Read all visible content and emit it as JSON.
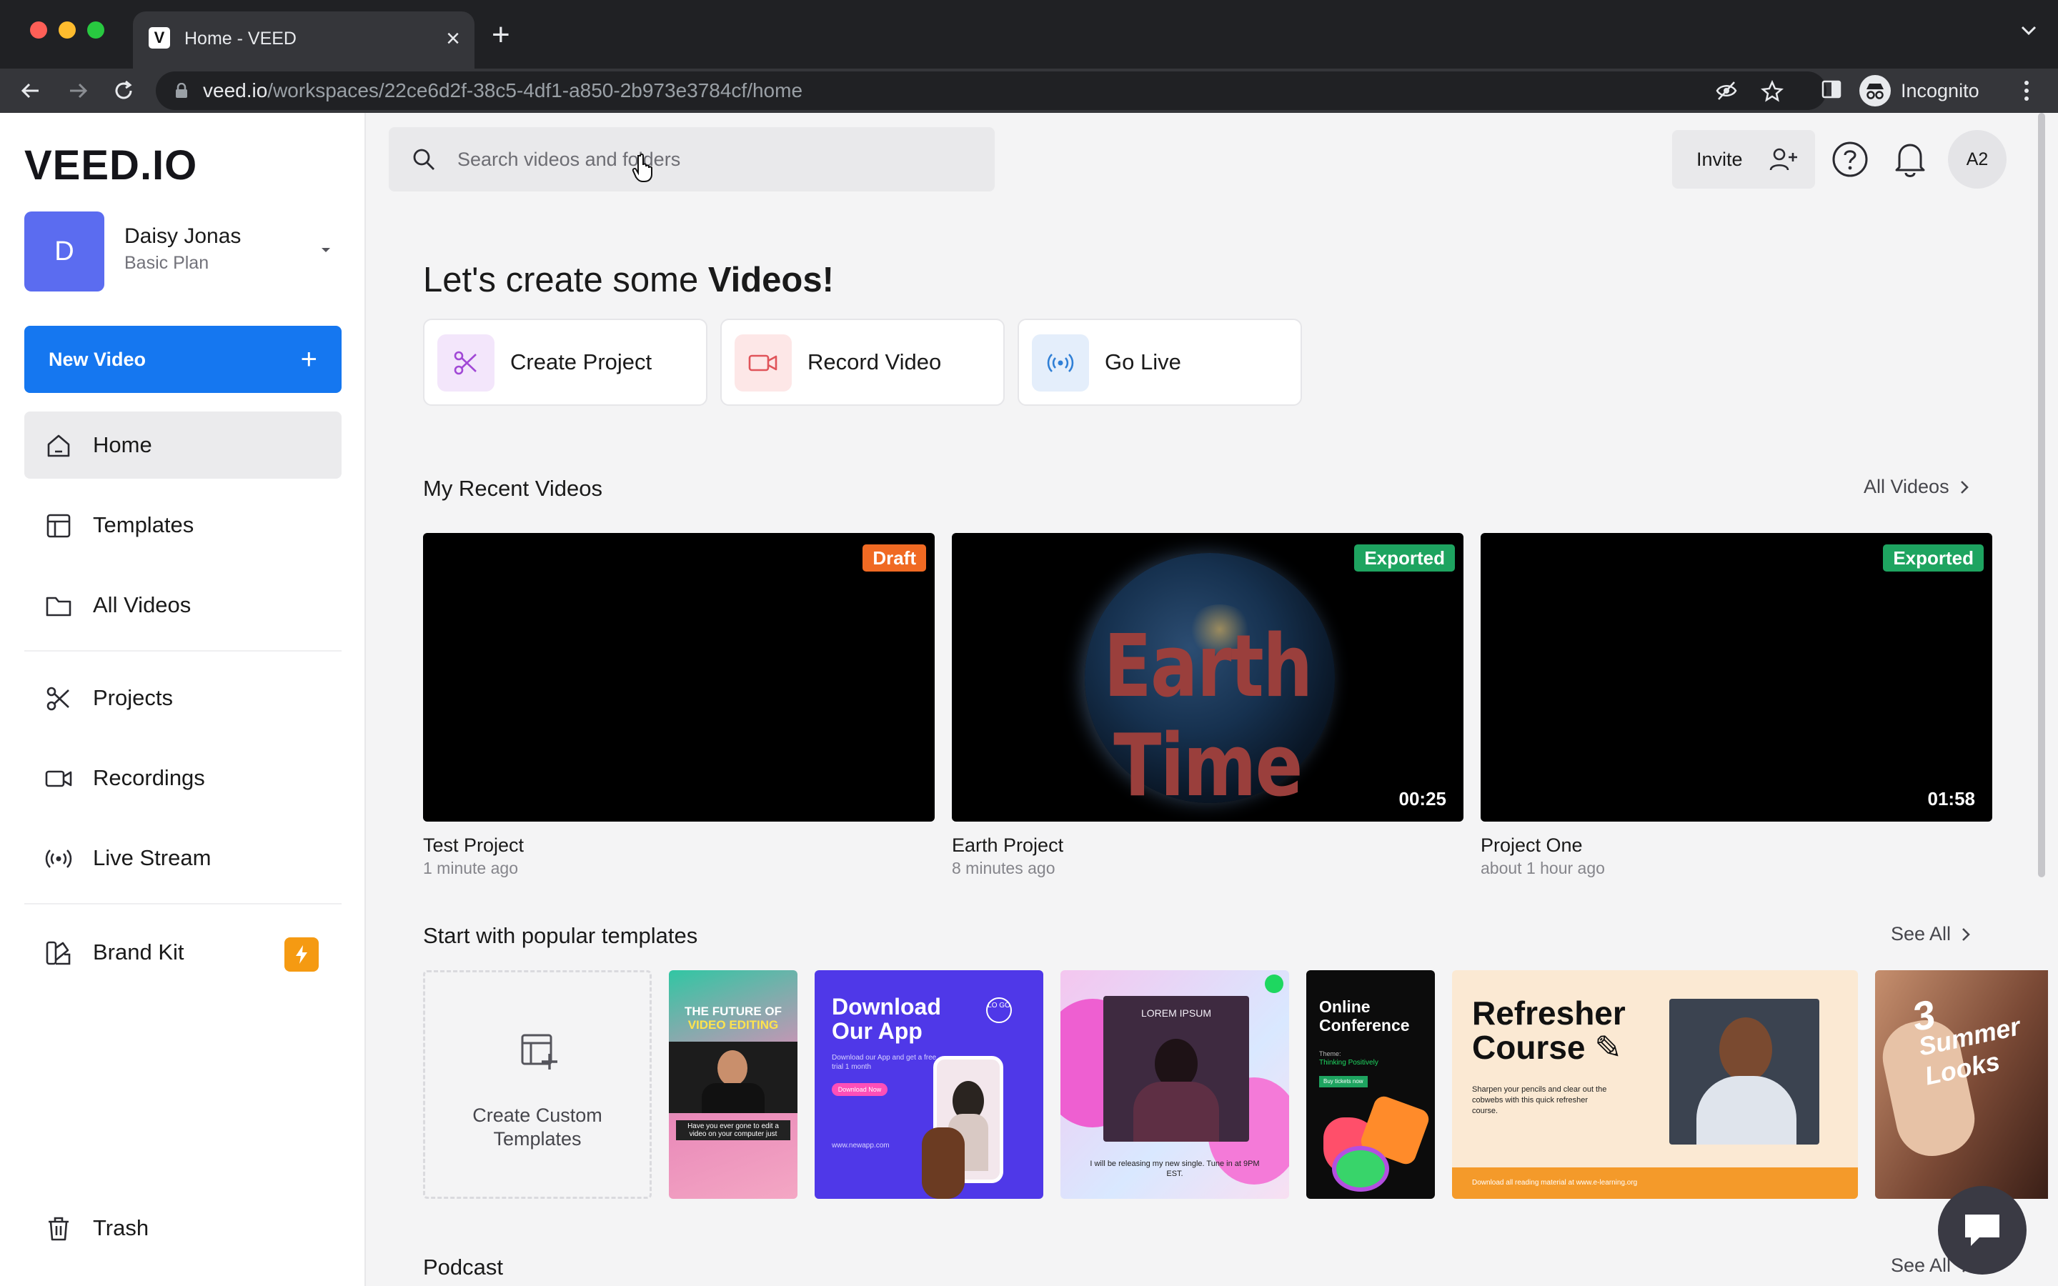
{
  "browser": {
    "tab_title": "Home - VEED",
    "tab_favicon": "V",
    "url_host": "veed.io",
    "url_path": "/workspaces/22ce6d2f-38c5-4df1-a850-2b973e3784cf/home",
    "profile_label": "Incognito"
  },
  "sidebar": {
    "logo": "VEED.IO",
    "account": {
      "initial": "D",
      "name": "Daisy Jonas",
      "plan": "Basic Plan"
    },
    "new_video_label": "New Video",
    "new_video_plus": "+",
    "items": [
      {
        "label": "Home",
        "icon": "home-icon"
      },
      {
        "label": "Templates",
        "icon": "templates-icon"
      },
      {
        "label": "All Videos",
        "icon": "folder-icon"
      },
      {
        "label": "Projects",
        "icon": "scissors-icon"
      },
      {
        "label": "Recordings",
        "icon": "camera-icon"
      },
      {
        "label": "Live Stream",
        "icon": "broadcast-icon"
      },
      {
        "label": "Brand Kit",
        "icon": "brand-kit-icon"
      },
      {
        "label": "Trash",
        "icon": "trash-icon"
      }
    ]
  },
  "header": {
    "search_placeholder": "Search videos and folders",
    "invite_label": "Invite",
    "user_initials": "A2"
  },
  "main": {
    "headline_prefix": "Let's create some ",
    "headline_bold": "Videos!",
    "quick_actions": [
      {
        "label": "Create Project",
        "icon": "scissors-icon",
        "color": "#a148d6"
      },
      {
        "label": "Record Video",
        "icon": "camera-icon",
        "color": "#e0545a"
      },
      {
        "label": "Go Live",
        "icon": "broadcast-icon",
        "color": "#2f7fd6"
      }
    ],
    "recent": {
      "title": "My Recent Videos",
      "see_all": "All Videos",
      "videos": [
        {
          "title": "Test Project",
          "time": "1 minute ago",
          "status": "Draft",
          "duration": ""
        },
        {
          "title": "Earth Project",
          "time": "8 minutes ago",
          "status": "Exported",
          "duration": "00:25",
          "thumb_text": "Earth Time"
        },
        {
          "title": "Project One",
          "time": "about 1 hour ago",
          "status": "Exported",
          "duration": "01:58"
        }
      ]
    },
    "templates": {
      "title": "Start with popular templates",
      "see_all": "See All",
      "custom_label": "Create Custom Templates",
      "items": [
        {
          "name": "future-of-video-editing",
          "lines": [
            "THE FUTURE OF",
            "VIDEO EDITING"
          ],
          "caption": "Have you ever gone to edit a video on your computer just"
        },
        {
          "name": "download-our-app",
          "lines": [
            "Download",
            "Our App"
          ],
          "sub": "Download our App and get a free trial 1 month",
          "button": "Download Now",
          "footer": "www.newapp.com",
          "logo": "LO GO"
        },
        {
          "name": "lorem-ipsum-single",
          "lines": [
            "LOREM IPSUM"
          ],
          "caption": "I will be releasing my new single. Tune in at 9PM EST."
        },
        {
          "name": "online-conference",
          "lines": [
            "Online",
            "Conference"
          ],
          "sub": "Theme:",
          "theme": "Thinking Positively",
          "button": "Buy tickets now"
        },
        {
          "name": "refresher-course",
          "lines": [
            "Refresher",
            "Course ✎"
          ],
          "sub": "Sharpen your pencils and clear out the cobwebs with this quick refresher course.",
          "footer": "Download all reading material at www.e-learning.org"
        },
        {
          "name": "summer-looks",
          "lines": [
            "3",
            "Summer",
            "Looks"
          ]
        }
      ]
    },
    "podcast": {
      "title": "Podcast",
      "see_all": "See All"
    }
  }
}
